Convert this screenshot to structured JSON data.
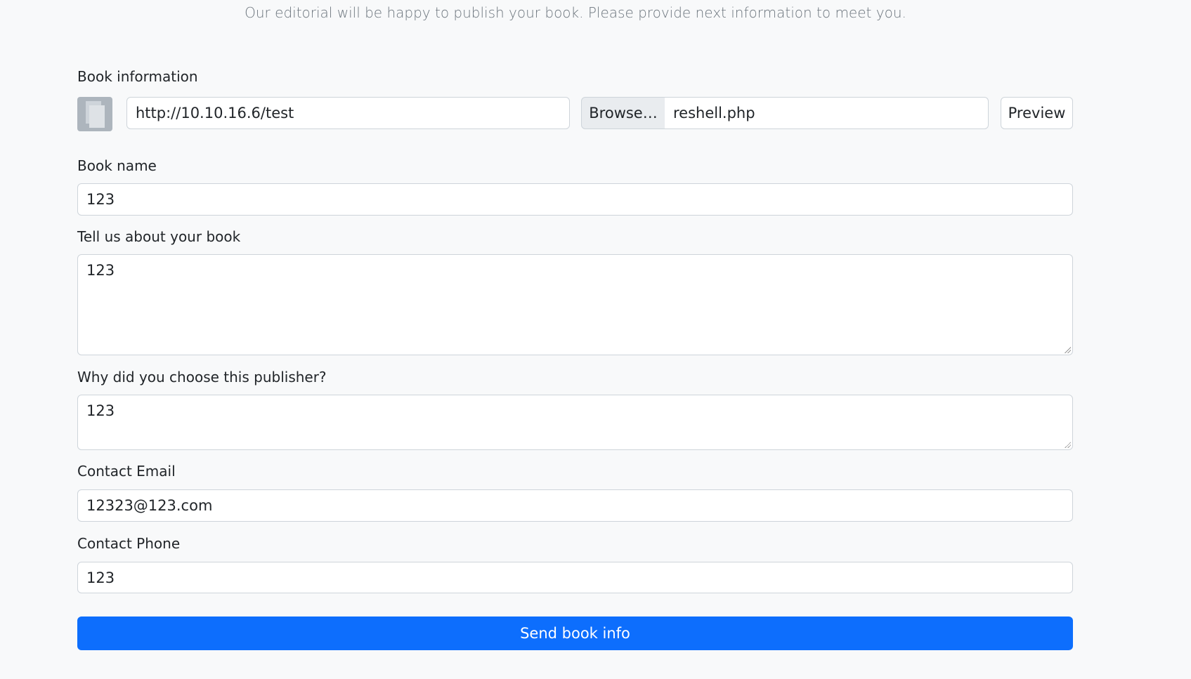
{
  "intro": "Our editorial will be happy to publish your book. Please provide next information to meet you.",
  "book_info": {
    "label": "Book information",
    "url_value": "http://10.10.16.6/test",
    "browse_label": "Browse…",
    "file_name": "reshell.php",
    "preview_label": "Preview"
  },
  "book_name": {
    "label": "Book name",
    "value": "123"
  },
  "about": {
    "label": "Tell us about your book",
    "value": "123"
  },
  "why": {
    "label": "Why did you choose this publisher?",
    "value": "123"
  },
  "email": {
    "label": "Contact Email",
    "value": "12323@123.com"
  },
  "phone": {
    "label": "Contact Phone",
    "value": "123"
  },
  "submit_label": "Send book info",
  "colors": {
    "primary": "#0d6efd",
    "background": "#f8f9fa"
  }
}
